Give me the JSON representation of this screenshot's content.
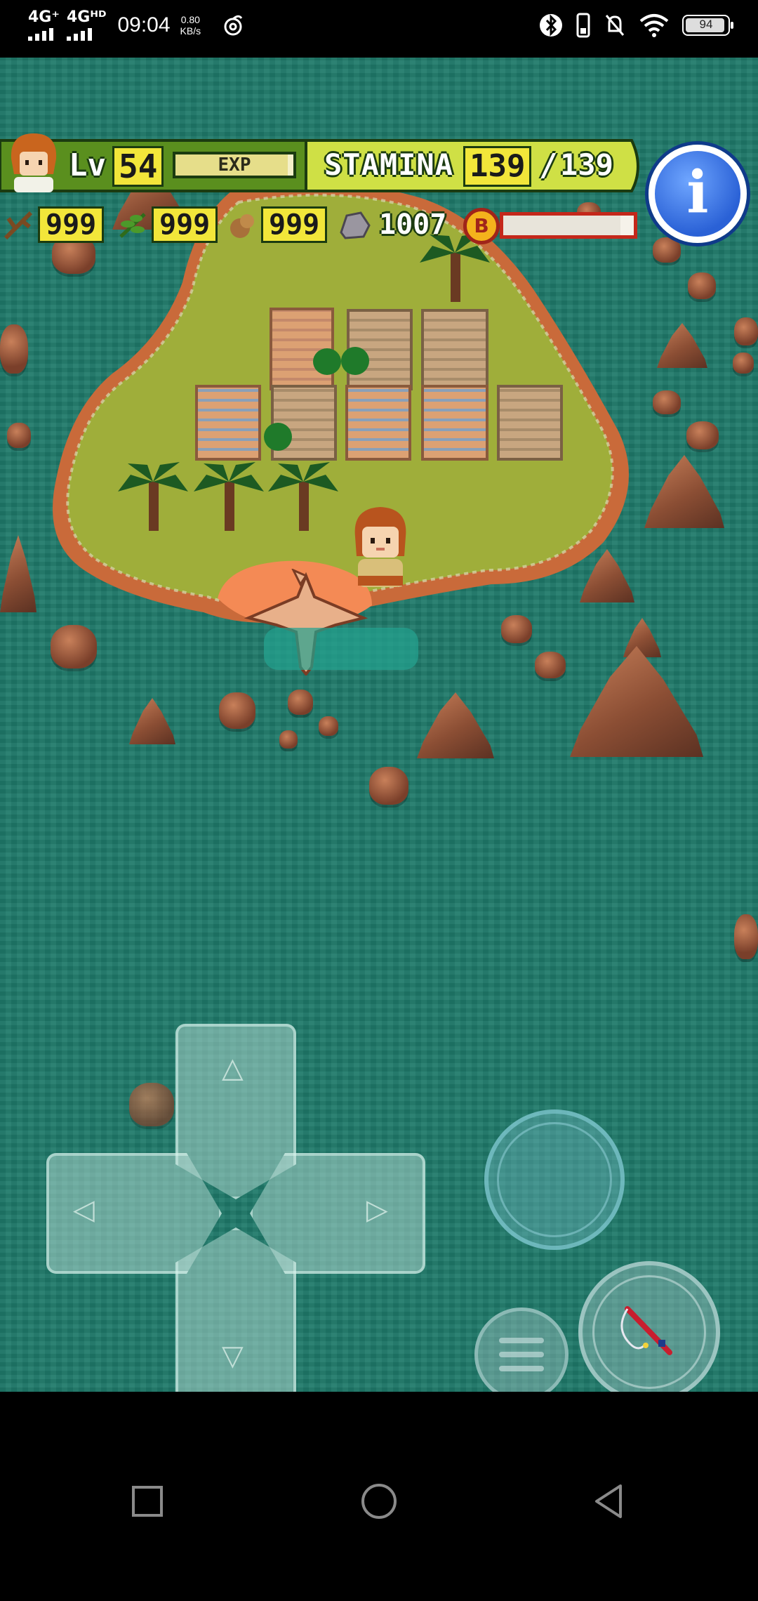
{
  "status_bar": {
    "network_1": "4G⁺",
    "network_2": "4Gᴴᴰ",
    "time": "09:04",
    "speed_value": "0.80",
    "speed_unit": "KB/s",
    "battery_percent": "94",
    "battery_level": 0.94
  },
  "hud": {
    "level_label": "Lv",
    "level_value": "54",
    "exp_label": "EXP",
    "exp_fill": 0.95,
    "stamina_label": "STAMINA",
    "stamina_current": "139",
    "stamina_separator": "/",
    "stamina_max": "139",
    "resources": [
      {
        "icon": "branch-icon",
        "value": "999"
      },
      {
        "icon": "herb-icon",
        "value": "999"
      },
      {
        "icon": "nut-icon",
        "value": "999"
      },
      {
        "icon": "stone-icon",
        "value": "1007"
      }
    ],
    "b_coin_label": "B",
    "b_bar_fill": 0.9,
    "info_label": "i"
  },
  "controls": {
    "up_arrow": "△",
    "down_arrow": "▽",
    "left_arrow": "◁",
    "right_arrow": "▷",
    "tool_icon": "fishing-rod-icon"
  },
  "nav": {
    "recents_icon": "square-icon",
    "home_icon": "circle-icon",
    "back_icon": "triangle-back-icon"
  },
  "colors": {
    "sea": "#1f7a6a",
    "grass": "#9fae3a",
    "hud_yellow": "#f2e63a",
    "hud_green": "#5a8f1e",
    "info_blue": "#2a61d6"
  }
}
